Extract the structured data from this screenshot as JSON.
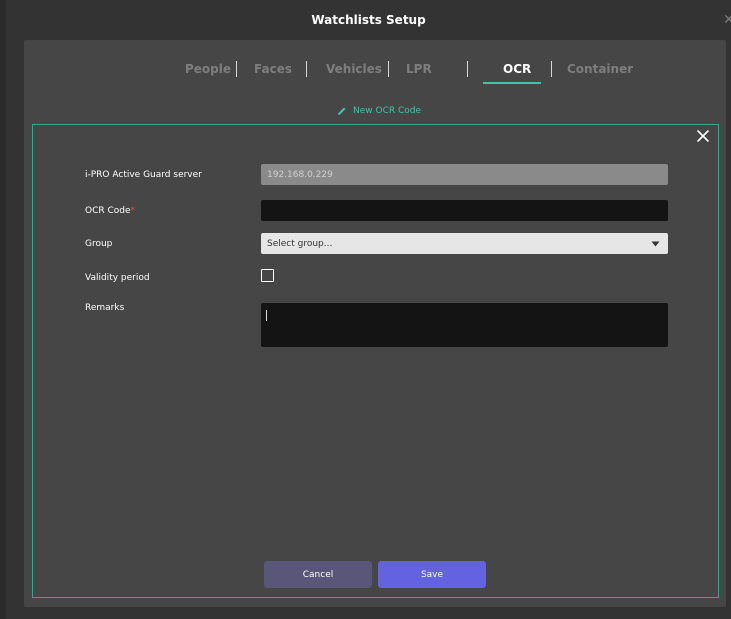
{
  "window": {
    "title": "Watchlists Setup",
    "close_glyph": "✕"
  },
  "tabs": [
    {
      "label": "People",
      "active": false
    },
    {
      "label": "Faces",
      "active": false
    },
    {
      "label": "Vehicles",
      "active": false
    },
    {
      "label": "LPR",
      "active": false
    },
    {
      "label": "OCR",
      "active": true
    },
    {
      "label": "Container",
      "active": false
    }
  ],
  "new_code": {
    "label": "New OCR Code",
    "icon": "pencil-icon"
  },
  "form": {
    "close_icon": "close-icon",
    "server": {
      "label": "i-PRO Active Guard server",
      "value": "192.168.0.229"
    },
    "ocr_code": {
      "label": "OCR Code",
      "required_mark": "*",
      "value": ""
    },
    "group": {
      "label": "Group",
      "placeholder": "Select group...",
      "icon": "chevron-down-icon"
    },
    "validity": {
      "label": "Validity period",
      "checked": false
    },
    "remarks": {
      "label": "Remarks",
      "value": ""
    }
  },
  "buttons": {
    "cancel": "Cancel",
    "save": "Save"
  },
  "colors": {
    "accent": "#47c1a8",
    "save": "#6363e2",
    "cancel": "#5a5679",
    "required": "#e05050"
  }
}
